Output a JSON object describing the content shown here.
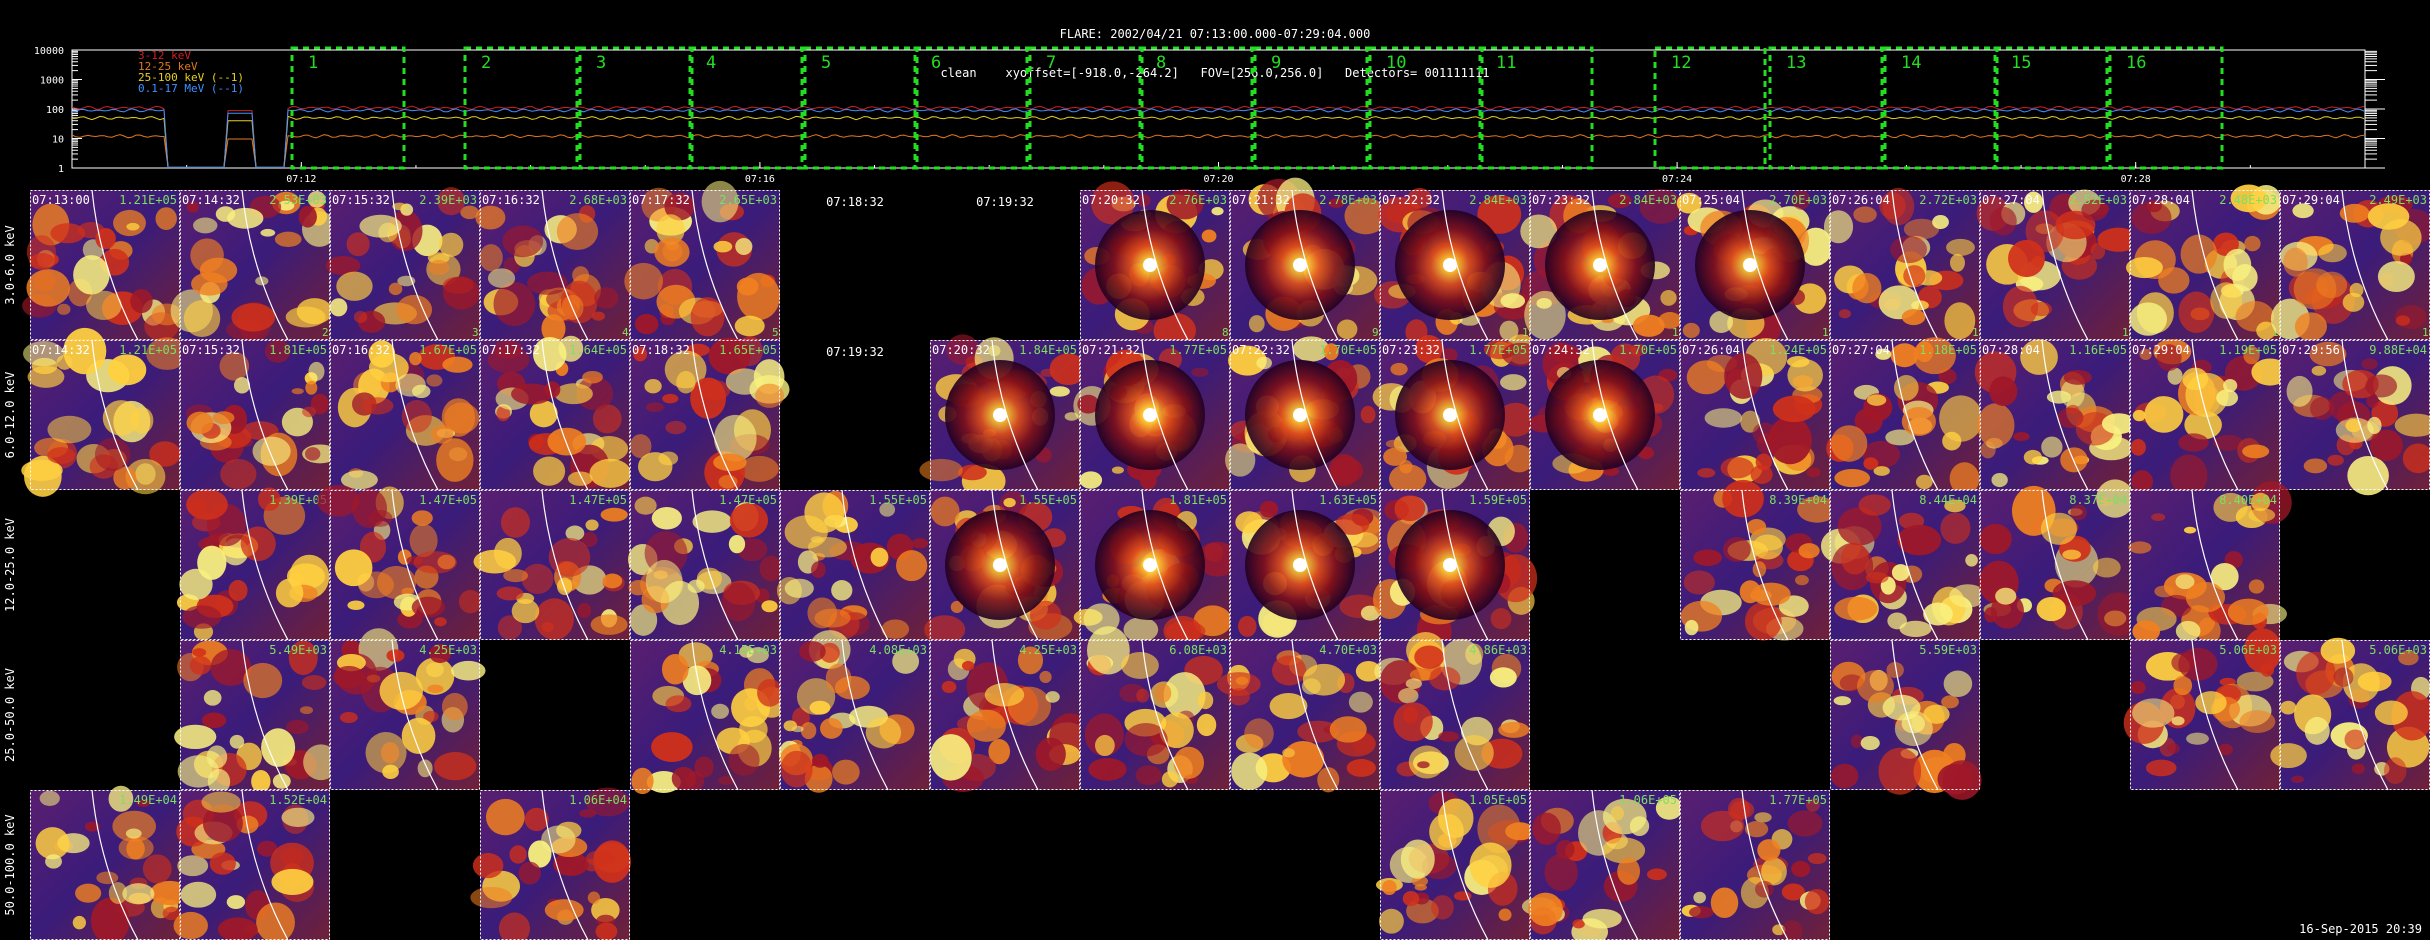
{
  "header": {
    "flare_line": "FLARE: 2002/04/21 07:13:00.000-07:29:04.000",
    "params_line": "clean    xyoffset=[-918.0,-264.2]   FOV=[256.0,256.0]   Detectors= 001111111"
  },
  "footer": {
    "date": "16-Sep-2015 20:39"
  },
  "lightcurve": {
    "y_ticks": [
      "10000",
      "1000",
      "100",
      "10",
      "1"
    ],
    "y_values": [
      10000,
      1000,
      100,
      10,
      1
    ],
    "time_ticks": [
      "07:12",
      "07:16",
      "07:20",
      "07:24",
      "07:28"
    ],
    "legend": [
      {
        "label": "3-12 keV",
        "color": "#d02020"
      },
      {
        "label": "12-25 keV",
        "color": "#e07820"
      },
      {
        "label": "25-100 keV (--1)",
        "color": "#e8d020"
      },
      {
        "label": "0.1-17 MeV (--1)",
        "color": "#4090ff"
      }
    ],
    "intervals": [
      "1",
      "2",
      "3",
      "4",
      "5",
      "6",
      "7",
      "8",
      "9",
      "10",
      "11",
      "12",
      "13",
      "14",
      "15",
      "16"
    ]
  },
  "chart_data": {
    "type": "image-grid",
    "lightcurve": {
      "type": "line",
      "ylog": true,
      "ylim": [
        1,
        10000
      ],
      "x_range": [
        "07:10:00",
        "07:30:00"
      ],
      "series": [
        {
          "name": "3-12 keV",
          "level": 110
        },
        {
          "name": "12-25 keV",
          "level": 12
        },
        {
          "name": "25-100 keV (--1)",
          "level": 50
        },
        {
          "name": "0.1-17 MeV (--1)",
          "level": 90
        }
      ],
      "interval_count": 16
    },
    "energy_bands": [
      "3.0-6.0 keV",
      "6.0-12.0 keV",
      "12.0-25.0 keV",
      "25.0-50.0 keV",
      "50.0-100.0 keV"
    ],
    "images": [
      [
        {
          "time": "07:13:00",
          "value": "1.21E+05",
          "num": ""
        },
        {
          "time": "07:14:32",
          "value": "2.53E+03",
          "num": "2"
        },
        {
          "time": "07:15:32",
          "value": "2.39E+03",
          "num": "3"
        },
        {
          "time": "07:16:32",
          "value": "2.68E+03",
          "num": "4"
        },
        {
          "time": "07:17:32",
          "value": "2.65E+03",
          "num": "5"
        },
        {
          "time": "07:18:32",
          "value": "",
          "num": "6",
          "empty": true
        },
        {
          "time": "07:19:32",
          "value": "",
          "num": "7",
          "empty": true
        },
        {
          "time": "07:20:32",
          "value": "2.76E+03",
          "num": "8"
        },
        {
          "time": "07:21:32",
          "value": "2.78E+03",
          "num": "9"
        },
        {
          "time": "07:22:32",
          "value": "2.84E+03",
          "num": "10"
        },
        {
          "time": "07:23:32",
          "value": "2.84E+03",
          "num": "11"
        },
        {
          "time": "07:25:04",
          "value": "2.70E+03",
          "num": "12"
        },
        {
          "time": "07:26:04",
          "value": "2.72E+03",
          "num": "13"
        },
        {
          "time": "07:27:04",
          "value": "2.52E+03",
          "num": "14"
        },
        {
          "time": "07:28:04",
          "value": "2.48E+03",
          "num": "15"
        },
        {
          "time": "07:29:04",
          "value": "2.49E+03",
          "num": "16"
        }
      ],
      [
        {
          "time": "07:14:32",
          "value": "1.21E+05",
          "num": ""
        },
        {
          "time": "07:15:32",
          "value": "1.81E+05",
          "num": ""
        },
        {
          "time": "07:16:32",
          "value": "1.67E+05",
          "num": ""
        },
        {
          "time": "07:17:32",
          "value": "1.64E+05",
          "num": ""
        },
        {
          "time": "07:18:32",
          "value": "1.65E+05",
          "num": ""
        },
        {
          "time": "07:19:32",
          "value": "",
          "num": "",
          "empty": true
        },
        {
          "time": "07:20:32",
          "value": "1.84E+05",
          "num": ""
        },
        {
          "time": "07:21:32",
          "value": "1.77E+05",
          "num": ""
        },
        {
          "time": "07:22:32",
          "value": "1.70E+05",
          "num": ""
        },
        {
          "time": "07:23:32",
          "value": "1.77E+05",
          "num": ""
        },
        {
          "time": "07:24:32",
          "value": "1.70E+05",
          "num": ""
        },
        {
          "time": "07:26:04",
          "value": "1.24E+05",
          "num": ""
        },
        {
          "time": "07:27:04",
          "value": "1.18E+05",
          "num": ""
        },
        {
          "time": "07:28:04",
          "value": "1.16E+05",
          "num": ""
        },
        {
          "time": "07:29:04",
          "value": "1.19E+05",
          "num": ""
        },
        {
          "time": "07:29:56",
          "value": "9.88E+04",
          "num": ""
        }
      ],
      [
        {
          "empty": true
        },
        {
          "value": "1.39E+05"
        },
        {
          "value": "1.47E+05"
        },
        {
          "value": "1.47E+05"
        },
        {
          "value": "1.47E+05"
        },
        {
          "value": "1.55E+05"
        },
        {
          "value": "1.55E+05"
        },
        {
          "value": "1.81E+05"
        },
        {
          "value": "1.63E+05"
        },
        {
          "value": "1.59E+05"
        },
        {
          "empty": true
        },
        {
          "value": "8.39E+04"
        },
        {
          "value": "8.44E+04"
        },
        {
          "value": "8.37E+04"
        },
        {
          "value": "8.40E+04"
        },
        {
          "empty": true
        }
      ],
      [
        {
          "empty": true
        },
        {
          "value": "5.49E+03"
        },
        {
          "value": "4.25E+03"
        },
        {
          "empty": true
        },
        {
          "value": "4.15E+03"
        },
        {
          "value": "4.08E+03"
        },
        {
          "value": "4.25E+03"
        },
        {
          "value": "6.08E+03"
        },
        {
          "value": "4.70E+03"
        },
        {
          "value": "4.86E+03"
        },
        {
          "empty": true
        },
        {
          "empty": true
        },
        {
          "value": "5.59E+03"
        },
        {
          "empty": true
        },
        {
          "value": "5.06E+03"
        },
        {
          "value": "5.06E+03"
        }
      ],
      [
        {
          "value": "1.49E+04"
        },
        {
          "value": "1.52E+04"
        },
        {
          "empty": true
        },
        {
          "value": "1.06E+04"
        },
        {
          "empty": true
        },
        {
          "empty": true
        },
        {
          "empty": true
        },
        {
          "empty": true
        },
        {
          "empty": true
        },
        {
          "value": "1.05E+05"
        },
        {
          "value": "1.06E+05"
        },
        {
          "value": "1.77E+05"
        },
        {
          "empty": true
        },
        {
          "empty": true
        },
        {
          "empty": true
        },
        {
          "empty": true
        }
      ]
    ]
  }
}
